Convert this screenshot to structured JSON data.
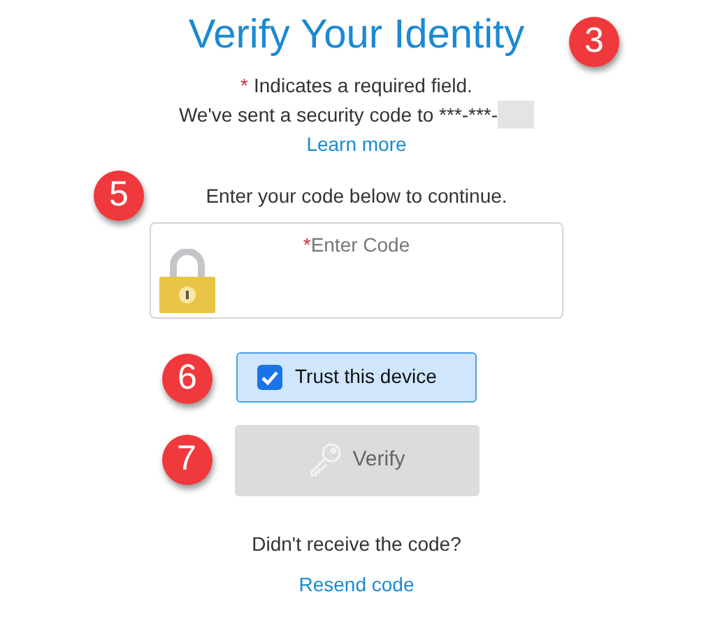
{
  "title": {
    "text": "Verify Your Identity",
    "callout": "3"
  },
  "required_note": {
    "marker": "*",
    "text": "Indicates a required field."
  },
  "sent_message": {
    "text": "We've sent a security code to ***-***-",
    "redacted": true
  },
  "learn_more": "Learn more",
  "instruction": {
    "text": "Enter your code below to continue.",
    "callout": "5"
  },
  "code_field": {
    "marker": "*",
    "placeholder": "Enter Code"
  },
  "trust_device": {
    "label": "Trust this device",
    "checked": true,
    "callout": "6"
  },
  "verify_button": {
    "label": "Verify",
    "disabled": true,
    "callout": "7"
  },
  "resend_prompt": "Didn't receive the code?",
  "resend_link": "Resend code"
}
